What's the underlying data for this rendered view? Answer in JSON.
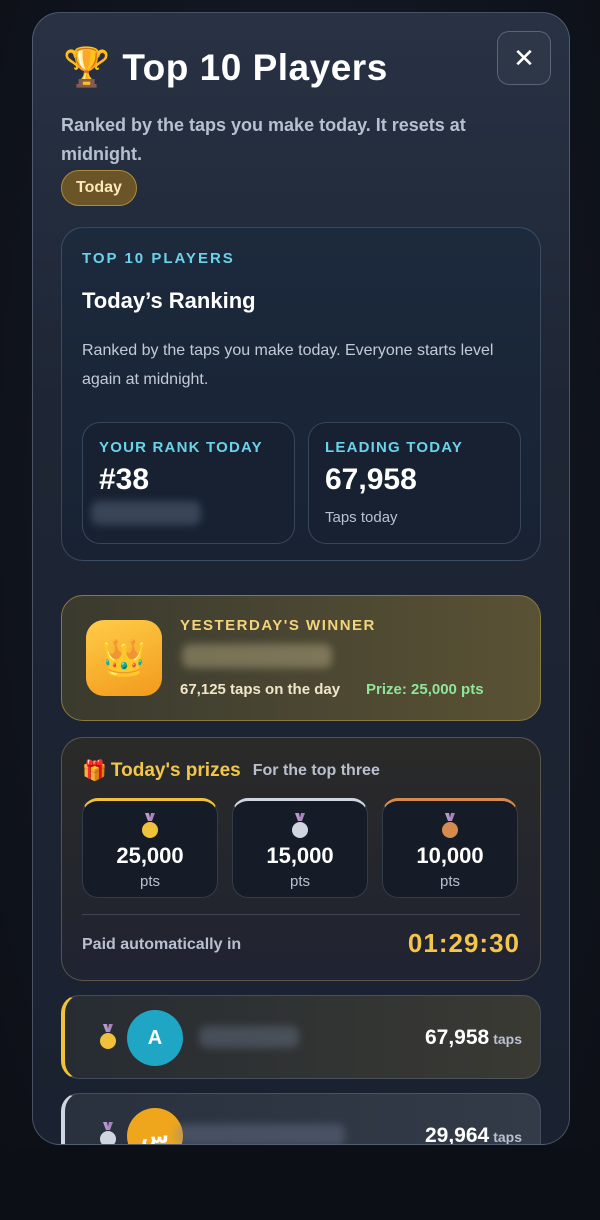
{
  "header": {
    "title": "Top 10 Players",
    "subtitle": "Ranked by the taps you make today. It resets at midnight.",
    "filter_pill": "Today",
    "close_glyph": "✕"
  },
  "ranking_card": {
    "eyebrow": "TOP 10 PLAYERS",
    "heading": "Today’s Ranking",
    "description": "Ranked by the taps you make today. Everyone starts level again at midnight.",
    "your_rank": {
      "label": "YOUR RANK TODAY",
      "value": "#38"
    },
    "leading": {
      "label": "LEADING TODAY",
      "value": "67,958",
      "sub": "Taps today"
    }
  },
  "winner": {
    "label": "YESTERDAY'S WINNER",
    "taps": "67,125 taps on the day",
    "prize": "Prize: 25,000 pts",
    "icon": "crown-icon"
  },
  "prizes": {
    "title": "Today's prizes",
    "subtitle": "For the top three",
    "items": [
      {
        "amount": "25,000",
        "unit": "pts",
        "medal": "gold-medal-icon",
        "color": "#f0c23c"
      },
      {
        "amount": "15,000",
        "unit": "pts",
        "medal": "silver-medal-icon",
        "color": "#cfd6e0"
      },
      {
        "amount": "10,000",
        "unit": "pts",
        "medal": "bronze-medal-icon",
        "color": "#d68b4e"
      }
    ],
    "paid_label": "Paid automatically in",
    "countdown": "01:29:30"
  },
  "leaderboard": [
    {
      "initial": "A",
      "taps": "67,958",
      "unit": "taps",
      "avatar_color": "#1fa6c4"
    },
    {
      "initial": "س",
      "taps": "29,964",
      "unit": "taps",
      "avatar_color": "#f0a61c"
    }
  ],
  "colors": {
    "accent_cyan": "#6ad3ea",
    "accent_gold": "#f3c64a",
    "accent_green": "#8fe59a"
  }
}
